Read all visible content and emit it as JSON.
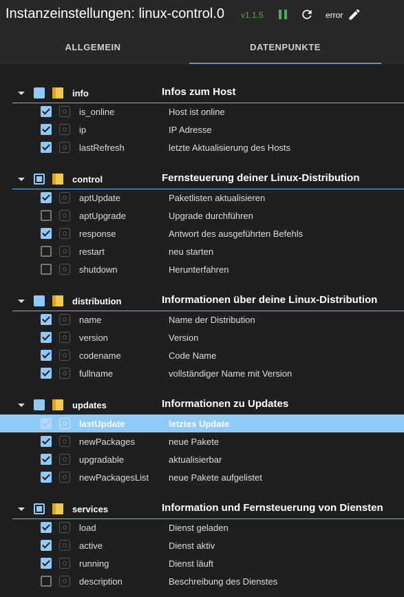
{
  "header": {
    "title": "Instanzeinstellungen: linux-control.0",
    "version": "v1.1.5",
    "status": "error",
    "icons": {
      "pause": "pause-icon",
      "reload": "reload-icon",
      "edit": "pencil-icon"
    }
  },
  "tabs": [
    {
      "label": "ALLGEMEIN"
    },
    {
      "label": "DATENPUNKTE"
    }
  ],
  "colors": {
    "accent": "#90caf9",
    "success": "#4caf50",
    "folder": "#f2c94c",
    "background": "#1f1f1f"
  },
  "groups": [
    {
      "name": "info",
      "description": "Infos zum Host",
      "check": "full",
      "items": [
        {
          "name": "is_online",
          "description": "Host ist online",
          "checked": true
        },
        {
          "name": "ip",
          "description": "IP Adresse",
          "checked": true
        },
        {
          "name": "lastRefresh",
          "description": "letzte Aktualisierung des Hosts",
          "checked": true
        }
      ]
    },
    {
      "name": "control",
      "description": "Fernsteuerung deiner Linux-Distribution",
      "check": "partial",
      "items": [
        {
          "name": "aptUpdate",
          "description": "Paketlisten aktualisieren",
          "checked": true
        },
        {
          "name": "aptUpgrade",
          "description": "Upgrade durchführen",
          "checked": false
        },
        {
          "name": "response",
          "description": "Antwort des ausgeführten Befehls",
          "checked": true
        },
        {
          "name": "restart",
          "description": "neu starten",
          "checked": false
        },
        {
          "name": "shutdown",
          "description": "Herunterfahren",
          "checked": false
        }
      ]
    },
    {
      "name": "distribution",
      "description": "Informationen über deine Linux-Distribution",
      "check": "full",
      "items": [
        {
          "name": "name",
          "description": "Name der Distribution",
          "checked": true
        },
        {
          "name": "version",
          "description": "Version",
          "checked": true
        },
        {
          "name": "codename",
          "description": "Code Name",
          "checked": true
        },
        {
          "name": "fullname",
          "description": "vollständiger Name mit Version",
          "checked": true
        }
      ]
    },
    {
      "name": "updates",
      "description": "Informationen zu Updates",
      "check": "full",
      "items": [
        {
          "name": "lastUpdate",
          "description": "letztes Update",
          "checked": true,
          "selected": true
        },
        {
          "name": "newPackages",
          "description": "neue Pakete",
          "checked": true
        },
        {
          "name": "upgradable",
          "description": "aktualisierbar",
          "checked": true
        },
        {
          "name": "newPackagesList",
          "description": "neue Pakete aufgelistet",
          "checked": true
        }
      ]
    },
    {
      "name": "services",
      "description": "Information und Fernsteuerung von Diensten",
      "check": "partial",
      "items": [
        {
          "name": "load",
          "description": "Dienst geladen",
          "checked": true
        },
        {
          "name": "active",
          "description": "Dienst aktiv",
          "checked": true
        },
        {
          "name": "running",
          "description": "Dienst läuft",
          "checked": true
        },
        {
          "name": "description",
          "description": "Beschreibung des Dienstes",
          "checked": false
        }
      ]
    }
  ]
}
